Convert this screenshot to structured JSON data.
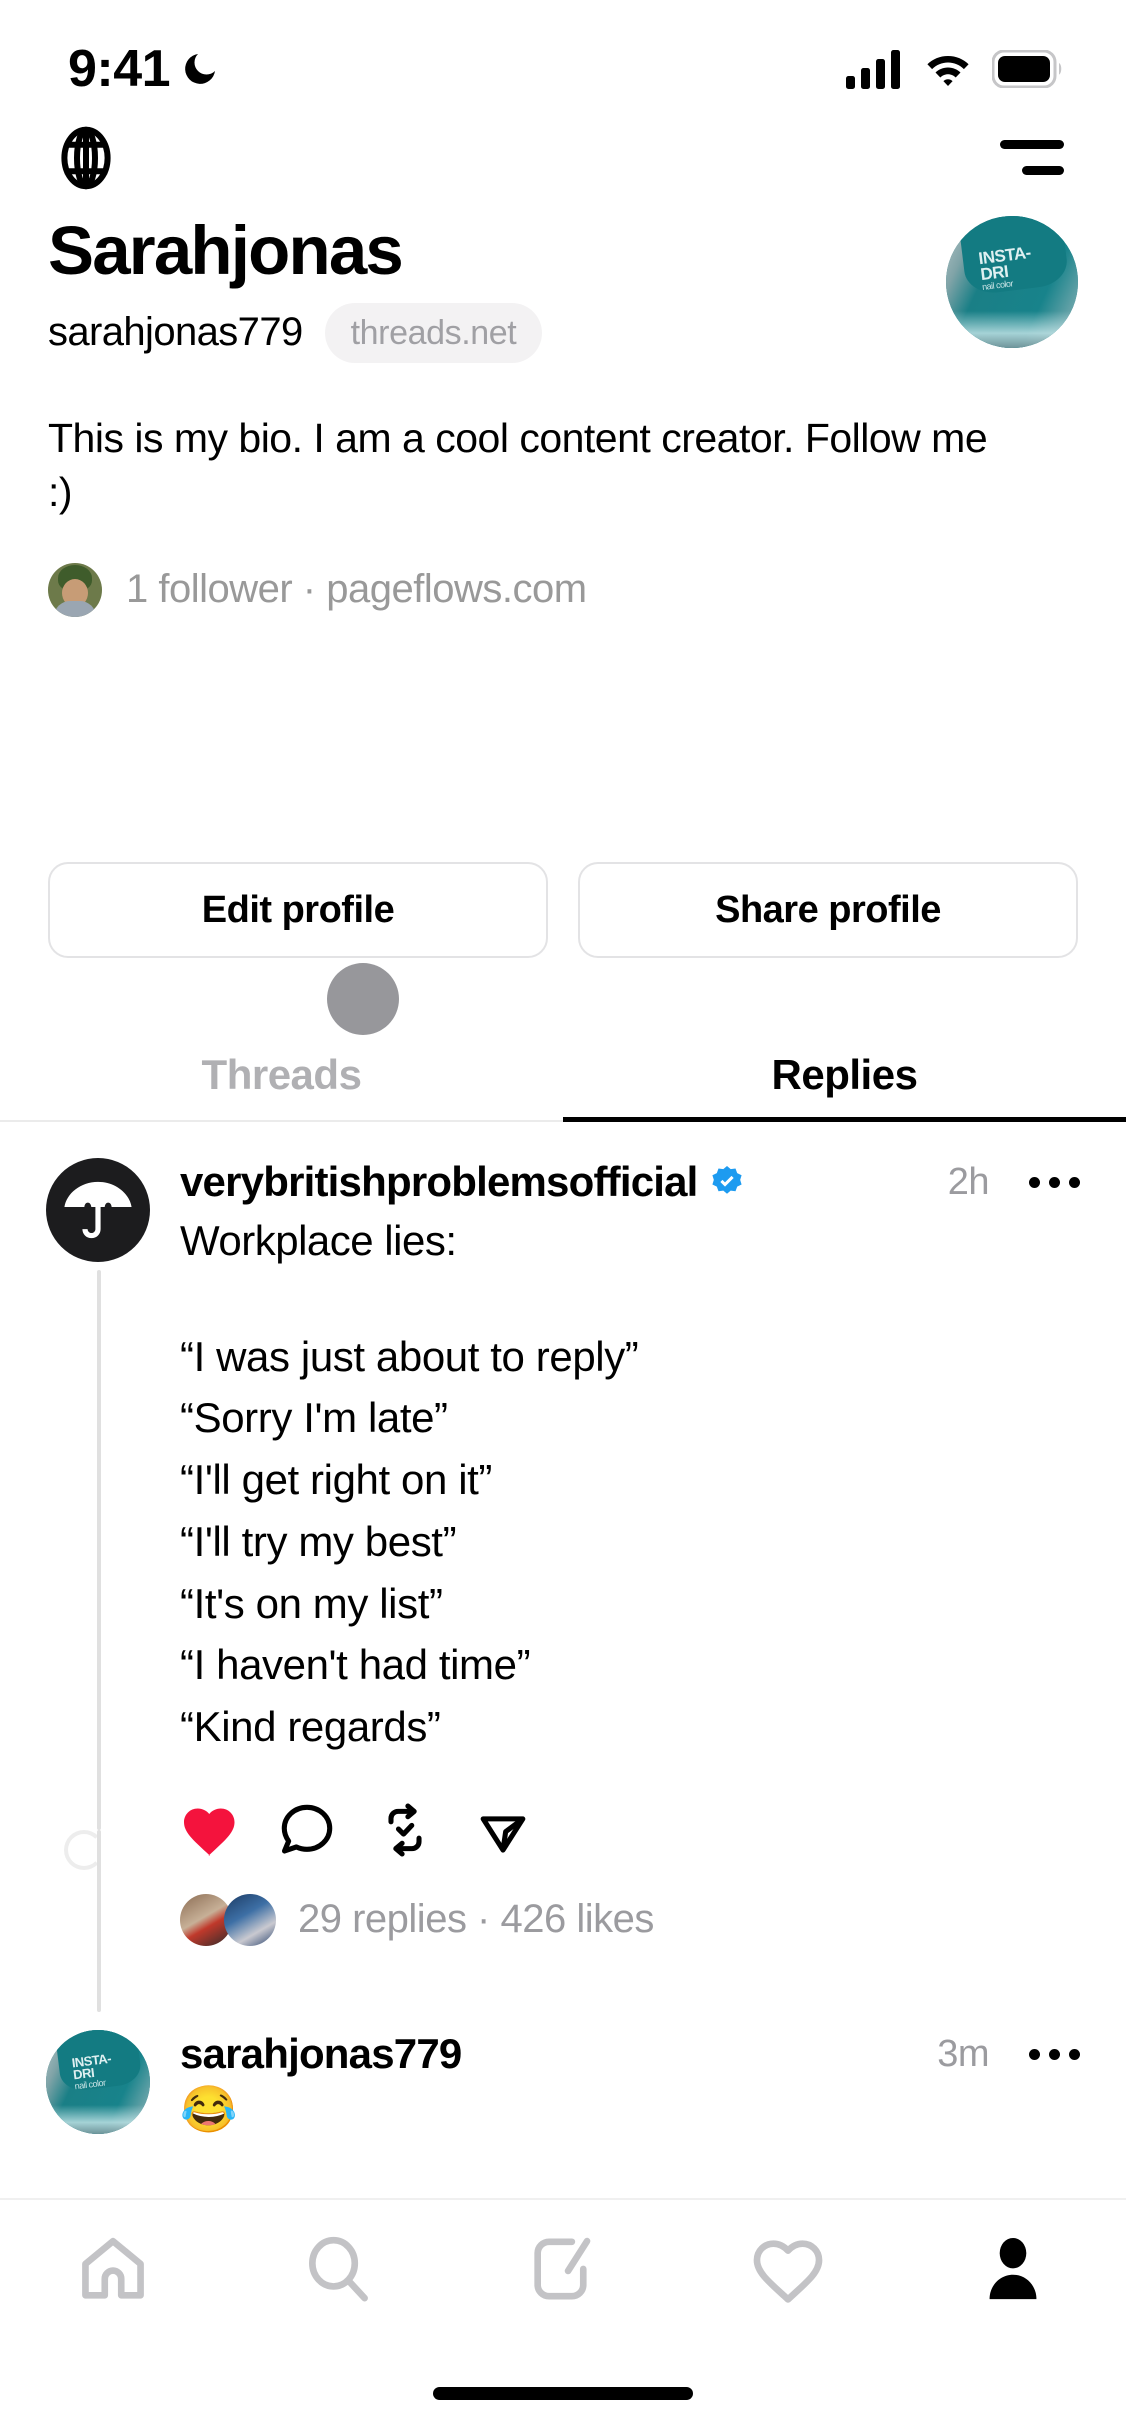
{
  "status_bar": {
    "time": "9:41",
    "dnd_icon": "moon-icon",
    "signal_icon": "cellular-signal-icon",
    "wifi_icon": "wifi-icon",
    "battery_icon": "battery-full-icon"
  },
  "top_nav": {
    "globe_icon": "globe-icon",
    "menu_icon": "hamburger-menu-icon"
  },
  "profile": {
    "display_name": "Sarahjonas",
    "username": "sarahjonas779",
    "domain_badge": "threads.net",
    "bio": "This is my bio. I am a cool content creator. Follow me :)",
    "followers_text": "1 follower · pageflows.com",
    "avatar_alt": "nail-polish-bottle-avatar",
    "follower_avatar_alt": "follower-thumbnail"
  },
  "actions": {
    "edit_profile": "Edit profile",
    "share_profile": "Share profile"
  },
  "tabs": [
    {
      "label": "Threads",
      "active": false
    },
    {
      "label": "Replies",
      "active": true
    }
  ],
  "post": {
    "author": "verybritishproblemsofficial",
    "verified": true,
    "verified_color": "#1d9bf0",
    "timestamp": "2h",
    "more_icon": "ellipsis-icon",
    "text": "Workplace lies:",
    "quotes": [
      "“I was just about to reply”",
      "“Sorry I'm late”",
      "“I'll get right on it”",
      "“I'll try my best”",
      "“It's on my list”",
      "“I haven't had time”",
      "“Kind regards”"
    ],
    "action_icons": [
      {
        "name": "heart-icon",
        "state": "liked",
        "color": "#f4133d"
      },
      {
        "name": "comment-icon",
        "state": "default",
        "color": "#000000"
      },
      {
        "name": "repost-icon",
        "state": "reposted",
        "color": "#000000"
      },
      {
        "name": "share-icon",
        "state": "default",
        "color": "#000000"
      }
    ],
    "meta_text": "29 replies · 426 likes",
    "replies_count": "29 replies",
    "likes_count": "426 likes",
    "avatar_alt": "umbrella-avatar"
  },
  "reply": {
    "author": "sarahjonas779",
    "timestamp": "3m",
    "more_icon": "ellipsis-icon",
    "emoji": "😂",
    "avatar_alt": "nail-polish-bottle-avatar"
  },
  "bottom_nav": [
    {
      "name": "home-icon",
      "label": "Home",
      "active": false
    },
    {
      "name": "search-icon",
      "label": "Search",
      "active": false
    },
    {
      "name": "compose-icon",
      "label": "Create",
      "active": false
    },
    {
      "name": "activity-heart-icon",
      "label": "Activity",
      "active": false
    },
    {
      "name": "profile-icon",
      "label": "Profile",
      "active": true
    }
  ],
  "colors": {
    "accent_verified": "#1d9bf0",
    "like_red": "#f4133d",
    "muted_gray": "#9b9b9f",
    "border": "#e3e3e5",
    "avatar_teal": "#1a7f86"
  }
}
